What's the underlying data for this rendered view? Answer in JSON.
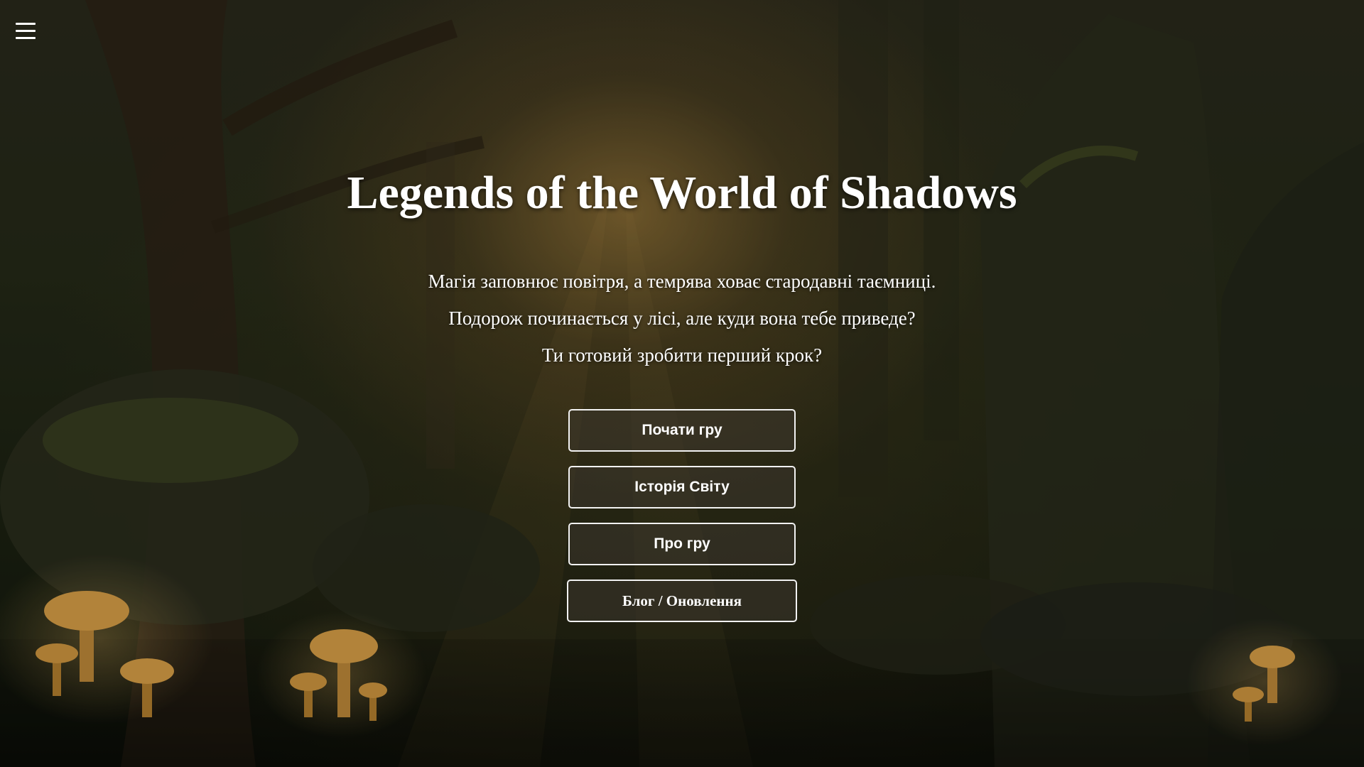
{
  "menu": {
    "icon": "hamburger-menu-icon"
  },
  "hero": {
    "title": "Legends of the World of Shadows",
    "lines": [
      "Магія заповнює повітря, а темрява ховає стародавні таємниці.",
      "Подорож починається у лісі, але куди вона тебе приведе?",
      "Ти готовий зробити перший крок?"
    ]
  },
  "buttons": {
    "start": "Почати гру",
    "history": "Історія Світу",
    "about": "Про гру",
    "blog": "Блог / Оновлення"
  },
  "colors": {
    "text": "#ffffff",
    "button_border": "#f2f2f2",
    "mushroom_glow": "#e0a640"
  }
}
